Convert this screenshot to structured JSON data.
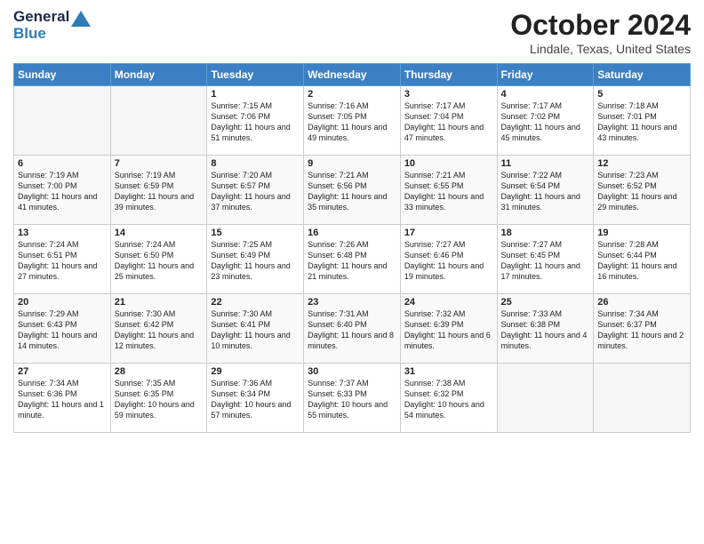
{
  "header": {
    "logo_line1": "General",
    "logo_line2": "Blue",
    "month": "October 2024",
    "location": "Lindale, Texas, United States"
  },
  "weekdays": [
    "Sunday",
    "Monday",
    "Tuesday",
    "Wednesday",
    "Thursday",
    "Friday",
    "Saturday"
  ],
  "weeks": [
    [
      {
        "day": "",
        "info": ""
      },
      {
        "day": "",
        "info": ""
      },
      {
        "day": "1",
        "info": "Sunrise: 7:15 AM\nSunset: 7:06 PM\nDaylight: 11 hours and 51 minutes."
      },
      {
        "day": "2",
        "info": "Sunrise: 7:16 AM\nSunset: 7:05 PM\nDaylight: 11 hours and 49 minutes."
      },
      {
        "day": "3",
        "info": "Sunrise: 7:17 AM\nSunset: 7:04 PM\nDaylight: 11 hours and 47 minutes."
      },
      {
        "day": "4",
        "info": "Sunrise: 7:17 AM\nSunset: 7:02 PM\nDaylight: 11 hours and 45 minutes."
      },
      {
        "day": "5",
        "info": "Sunrise: 7:18 AM\nSunset: 7:01 PM\nDaylight: 11 hours and 43 minutes."
      }
    ],
    [
      {
        "day": "6",
        "info": "Sunrise: 7:19 AM\nSunset: 7:00 PM\nDaylight: 11 hours and 41 minutes."
      },
      {
        "day": "7",
        "info": "Sunrise: 7:19 AM\nSunset: 6:59 PM\nDaylight: 11 hours and 39 minutes."
      },
      {
        "day": "8",
        "info": "Sunrise: 7:20 AM\nSunset: 6:57 PM\nDaylight: 11 hours and 37 minutes."
      },
      {
        "day": "9",
        "info": "Sunrise: 7:21 AM\nSunset: 6:56 PM\nDaylight: 11 hours and 35 minutes."
      },
      {
        "day": "10",
        "info": "Sunrise: 7:21 AM\nSunset: 6:55 PM\nDaylight: 11 hours and 33 minutes."
      },
      {
        "day": "11",
        "info": "Sunrise: 7:22 AM\nSunset: 6:54 PM\nDaylight: 11 hours and 31 minutes."
      },
      {
        "day": "12",
        "info": "Sunrise: 7:23 AM\nSunset: 6:52 PM\nDaylight: 11 hours and 29 minutes."
      }
    ],
    [
      {
        "day": "13",
        "info": "Sunrise: 7:24 AM\nSunset: 6:51 PM\nDaylight: 11 hours and 27 minutes."
      },
      {
        "day": "14",
        "info": "Sunrise: 7:24 AM\nSunset: 6:50 PM\nDaylight: 11 hours and 25 minutes."
      },
      {
        "day": "15",
        "info": "Sunrise: 7:25 AM\nSunset: 6:49 PM\nDaylight: 11 hours and 23 minutes."
      },
      {
        "day": "16",
        "info": "Sunrise: 7:26 AM\nSunset: 6:48 PM\nDaylight: 11 hours and 21 minutes."
      },
      {
        "day": "17",
        "info": "Sunrise: 7:27 AM\nSunset: 6:46 PM\nDaylight: 11 hours and 19 minutes."
      },
      {
        "day": "18",
        "info": "Sunrise: 7:27 AM\nSunset: 6:45 PM\nDaylight: 11 hours and 17 minutes."
      },
      {
        "day": "19",
        "info": "Sunrise: 7:28 AM\nSunset: 6:44 PM\nDaylight: 11 hours and 16 minutes."
      }
    ],
    [
      {
        "day": "20",
        "info": "Sunrise: 7:29 AM\nSunset: 6:43 PM\nDaylight: 11 hours and 14 minutes."
      },
      {
        "day": "21",
        "info": "Sunrise: 7:30 AM\nSunset: 6:42 PM\nDaylight: 11 hours and 12 minutes."
      },
      {
        "day": "22",
        "info": "Sunrise: 7:30 AM\nSunset: 6:41 PM\nDaylight: 11 hours and 10 minutes."
      },
      {
        "day": "23",
        "info": "Sunrise: 7:31 AM\nSunset: 6:40 PM\nDaylight: 11 hours and 8 minutes."
      },
      {
        "day": "24",
        "info": "Sunrise: 7:32 AM\nSunset: 6:39 PM\nDaylight: 11 hours and 6 minutes."
      },
      {
        "day": "25",
        "info": "Sunrise: 7:33 AM\nSunset: 6:38 PM\nDaylight: 11 hours and 4 minutes."
      },
      {
        "day": "26",
        "info": "Sunrise: 7:34 AM\nSunset: 6:37 PM\nDaylight: 11 hours and 2 minutes."
      }
    ],
    [
      {
        "day": "27",
        "info": "Sunrise: 7:34 AM\nSunset: 6:36 PM\nDaylight: 11 hours and 1 minute."
      },
      {
        "day": "28",
        "info": "Sunrise: 7:35 AM\nSunset: 6:35 PM\nDaylight: 10 hours and 59 minutes."
      },
      {
        "day": "29",
        "info": "Sunrise: 7:36 AM\nSunset: 6:34 PM\nDaylight: 10 hours and 57 minutes."
      },
      {
        "day": "30",
        "info": "Sunrise: 7:37 AM\nSunset: 6:33 PM\nDaylight: 10 hours and 55 minutes."
      },
      {
        "day": "31",
        "info": "Sunrise: 7:38 AM\nSunset: 6:32 PM\nDaylight: 10 hours and 54 minutes."
      },
      {
        "day": "",
        "info": ""
      },
      {
        "day": "",
        "info": ""
      }
    ]
  ]
}
